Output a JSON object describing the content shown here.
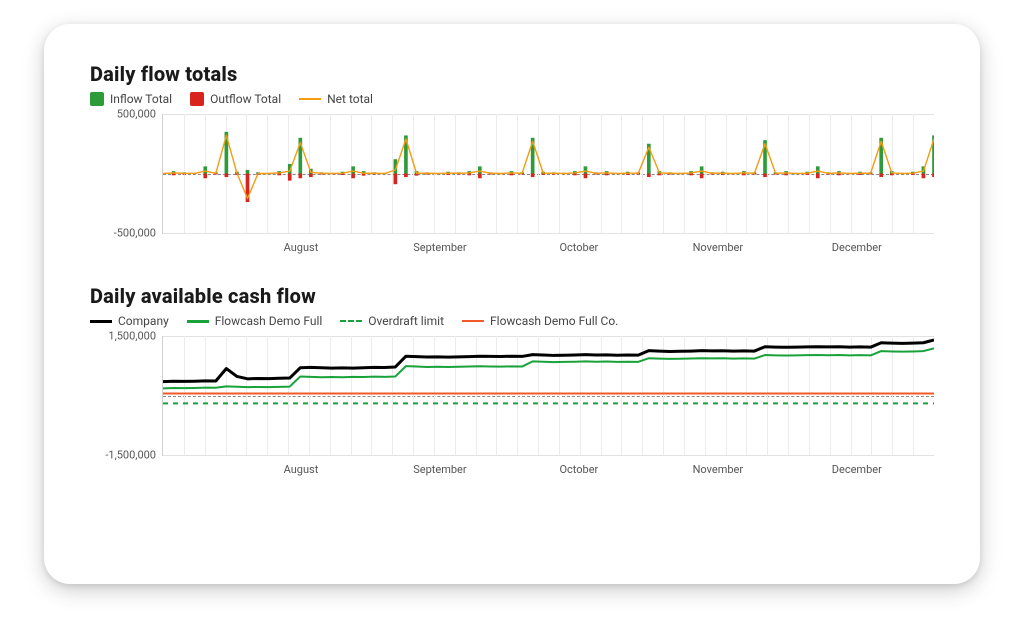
{
  "months": [
    "August",
    "September",
    "October",
    "November",
    "December"
  ],
  "month_positions_pct": [
    18,
    36,
    54,
    72,
    90
  ],
  "chart_data": [
    {
      "type": "line",
      "title": "Daily flow totals",
      "ylabel": "",
      "xlabel": "",
      "ylim": [
        -500000,
        500000
      ],
      "yticks": [
        -500000,
        0,
        500000
      ],
      "ytick_labels": [
        "-500,000",
        "",
        "500,000"
      ],
      "x_categories": [
        "August",
        "September",
        "October",
        "November",
        "December"
      ],
      "series": [
        {
          "name": "Inflow Total",
          "color": "#2e9b3a",
          "style": "bar",
          "values": [
            0,
            20000,
            10000,
            5000,
            60000,
            10000,
            350000,
            15000,
            30000,
            10000,
            5000,
            20000,
            80000,
            300000,
            40000,
            10000,
            5000,
            15000,
            60000,
            20000,
            10000,
            5000,
            120000,
            320000,
            20000,
            10000,
            5000,
            15000,
            10000,
            20000,
            60000,
            10000,
            5000,
            20000,
            10000,
            300000,
            15000,
            10000,
            5000,
            20000,
            60000,
            10000,
            20000,
            5000,
            15000,
            10000,
            250000,
            20000,
            10000,
            5000,
            20000,
            60000,
            10000,
            15000,
            5000,
            20000,
            10000,
            280000,
            10000,
            20000,
            5000,
            15000,
            60000,
            10000,
            20000,
            5000,
            15000,
            10000,
            300000,
            20000,
            5000,
            15000,
            60000,
            320000
          ]
        },
        {
          "name": "Outflow Total",
          "color": "#d9231f",
          "style": "bar",
          "values": [
            0,
            -15000,
            -8000,
            -4000,
            -40000,
            -8000,
            -30000,
            -12000,
            -240000,
            -10000,
            -5000,
            -15000,
            -60000,
            -40000,
            -30000,
            -8000,
            -5000,
            -12000,
            -40000,
            -18000,
            -8000,
            -5000,
            -90000,
            -30000,
            -18000,
            -8000,
            -5000,
            -12000,
            -8000,
            -15000,
            -40000,
            -8000,
            -5000,
            -15000,
            -8000,
            -30000,
            -12000,
            -8000,
            -5000,
            -15000,
            -40000,
            -8000,
            -15000,
            -5000,
            -12000,
            -8000,
            -30000,
            -15000,
            -8000,
            -5000,
            -15000,
            -40000,
            -8000,
            -12000,
            -5000,
            -15000,
            -8000,
            -30000,
            -8000,
            -15000,
            -5000,
            -12000,
            -40000,
            -8000,
            -15000,
            -5000,
            -12000,
            -8000,
            -30000,
            -15000,
            -5000,
            -12000,
            -40000,
            -30000
          ]
        },
        {
          "name": "Net total",
          "color": "#f39c12",
          "style": "line",
          "values": [
            0,
            5000,
            2000,
            1000,
            20000,
            2000,
            320000,
            3000,
            -210000,
            0,
            0,
            5000,
            20000,
            260000,
            10000,
            2000,
            0,
            3000,
            20000,
            2000,
            2000,
            0,
            30000,
            290000,
            2000,
            2000,
            0,
            3000,
            2000,
            5000,
            20000,
            2000,
            0,
            5000,
            2000,
            270000,
            3000,
            2000,
            0,
            5000,
            20000,
            2000,
            5000,
            0,
            3000,
            2000,
            220000,
            5000,
            2000,
            0,
            5000,
            20000,
            2000,
            3000,
            0,
            5000,
            2000,
            250000,
            2000,
            5000,
            0,
            3000,
            20000,
            2000,
            5000,
            0,
            3000,
            2000,
            270000,
            5000,
            0,
            3000,
            20000,
            290000
          ]
        }
      ]
    },
    {
      "type": "line",
      "title": "Daily available cash flow",
      "ylabel": "",
      "xlabel": "",
      "ylim": [
        -1500000,
        1500000
      ],
      "yticks": [
        -1500000,
        0,
        1500000
      ],
      "ytick_labels": [
        "-1,500,000",
        "",
        "1,500,000"
      ],
      "x_categories": [
        "August",
        "September",
        "October",
        "November",
        "December"
      ],
      "series": [
        {
          "name": "Company",
          "color": "#000",
          "style": "line",
          "weight": 3,
          "values": [
            350000,
            360000,
            355000,
            360000,
            370000,
            365000,
            680000,
            480000,
            420000,
            430000,
            425000,
            435000,
            440000,
            700000,
            710000,
            700000,
            690000,
            695000,
            690000,
            700000,
            710000,
            705000,
            720000,
            990000,
            980000,
            970000,
            975000,
            968000,
            975000,
            980000,
            990000,
            985000,
            982000,
            990000,
            985000,
            1030000,
            1020000,
            1010000,
            1015000,
            1020000,
            1030000,
            1020000,
            1025000,
            1015000,
            1020000,
            1018000,
            1130000,
            1120000,
            1110000,
            1115000,
            1120000,
            1130000,
            1125000,
            1128000,
            1120000,
            1125000,
            1120000,
            1230000,
            1220000,
            1215000,
            1218000,
            1225000,
            1230000,
            1225000,
            1228000,
            1220000,
            1225000,
            1218000,
            1330000,
            1320000,
            1315000,
            1320000,
            1330000,
            1400000
          ]
        },
        {
          "name": "Flowcash Demo Full",
          "color": "#19a23a",
          "style": "line",
          "weight": 2,
          "values": [
            180000,
            190000,
            185000,
            190000,
            200000,
            195000,
            230000,
            220000,
            210000,
            215000,
            210000,
            218000,
            225000,
            480000,
            470000,
            460000,
            465000,
            460000,
            470000,
            465000,
            475000,
            470000,
            480000,
            740000,
            730000,
            720000,
            725000,
            718000,
            725000,
            730000,
            738000,
            732000,
            728000,
            735000,
            730000,
            860000,
            850000,
            842000,
            848000,
            852000,
            860000,
            852000,
            858000,
            848000,
            852000,
            848000,
            940000,
            930000,
            922000,
            928000,
            932000,
            940000,
            935000,
            938000,
            930000,
            935000,
            930000,
            1020000,
            1012000,
            1008000,
            1012000,
            1018000,
            1022000,
            1016000,
            1020000,
            1012000,
            1018000,
            1010000,
            1120000,
            1110000,
            1105000,
            1110000,
            1120000,
            1190000
          ]
        },
        {
          "name": "Overdraft limit",
          "color": "#19a23a",
          "style": "dash",
          "weight": 2,
          "values": [
            -200000,
            -200000,
            -200000,
            -200000,
            -200000,
            -200000,
            -200000,
            -200000,
            -200000,
            -200000,
            -200000,
            -200000,
            -200000,
            -200000,
            -200000,
            -200000,
            -200000,
            -200000,
            -200000,
            -200000,
            -200000,
            -200000,
            -200000,
            -200000,
            -200000,
            -200000,
            -200000,
            -200000,
            -200000,
            -200000,
            -200000,
            -200000,
            -200000,
            -200000,
            -200000,
            -200000,
            -200000,
            -200000,
            -200000,
            -200000,
            -200000,
            -200000,
            -200000,
            -200000,
            -200000,
            -200000,
            -200000,
            -200000,
            -200000,
            -200000,
            -200000,
            -200000,
            -200000,
            -200000,
            -200000,
            -200000,
            -200000,
            -200000,
            -200000,
            -200000,
            -200000,
            -200000,
            -200000,
            -200000,
            -200000,
            -200000,
            -200000,
            -200000,
            -200000,
            -200000,
            -200000,
            -200000,
            -200000,
            -200000
          ]
        },
        {
          "name": "Flowcash Demo Full Co.",
          "color": "#f05a28",
          "style": "line",
          "weight": 2,
          "values": [
            50000,
            50000,
            50000,
            50000,
            50000,
            50000,
            50000,
            50000,
            50000,
            50000,
            50000,
            50000,
            50000,
            50000,
            50000,
            50000,
            50000,
            50000,
            50000,
            50000,
            50000,
            50000,
            50000,
            50000,
            50000,
            50000,
            50000,
            50000,
            50000,
            50000,
            50000,
            50000,
            50000,
            50000,
            50000,
            50000,
            50000,
            50000,
            50000,
            50000,
            50000,
            50000,
            50000,
            50000,
            50000,
            50000,
            50000,
            50000,
            50000,
            50000,
            50000,
            50000,
            50000,
            50000,
            50000,
            50000,
            50000,
            50000,
            50000,
            50000,
            50000,
            50000,
            50000,
            50000,
            50000,
            50000,
            50000,
            50000,
            50000,
            50000,
            50000,
            50000,
            50000,
            50000
          ]
        }
      ]
    }
  ]
}
